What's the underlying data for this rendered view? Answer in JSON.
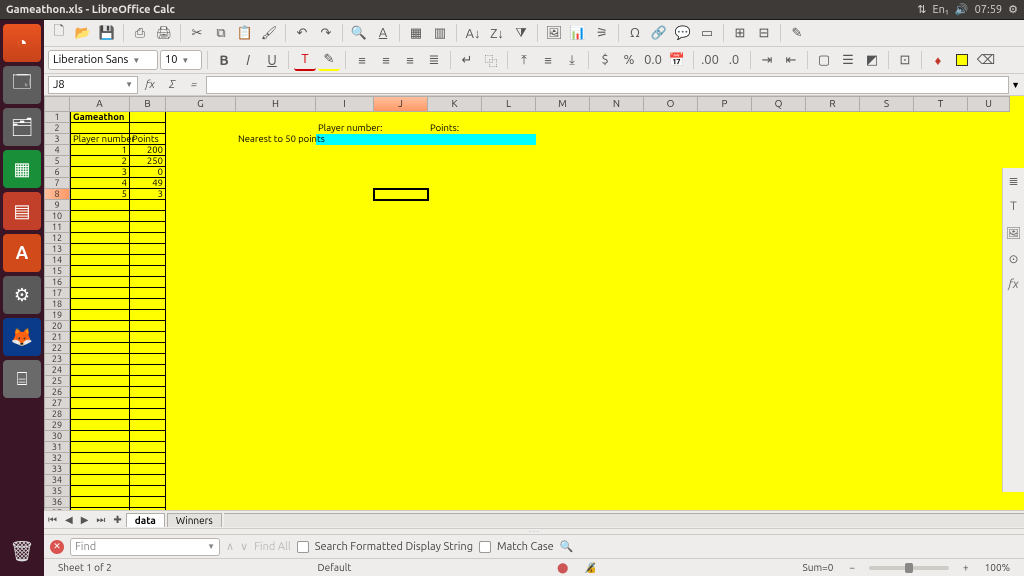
{
  "ubuntu": {
    "title": "Gameathon.xls - LibreOffice Calc",
    "time": "07:59",
    "lang": "En₁"
  },
  "launcher": {
    "apps": [
      {
        "name": "ubuntu-dash",
        "glyph": "⊚"
      },
      {
        "name": "files",
        "glyph": "🗂"
      },
      {
        "name": "files2",
        "glyph": "📁"
      },
      {
        "name": "calc",
        "glyph": "▦"
      },
      {
        "name": "impress",
        "glyph": "▤"
      },
      {
        "name": "store",
        "glyph": "A"
      },
      {
        "name": "settings",
        "glyph": "⚙"
      },
      {
        "name": "firefox",
        "glyph": "🦊"
      },
      {
        "name": "drive",
        "glyph": "⌸"
      }
    ]
  },
  "formatting": {
    "font": "Liberation Sans",
    "size": "10"
  },
  "namebox": "J8",
  "columns": [
    "A",
    "B",
    "G",
    "H",
    "I",
    "J",
    "K",
    "L",
    "M",
    "N",
    "O",
    "P",
    "Q",
    "R",
    "S",
    "T",
    "U"
  ],
  "col_widths": {
    "A": 60,
    "B": 36,
    "G": 70,
    "H": 80,
    "I": 58,
    "J": 54,
    "K": 54,
    "L": 54,
    "M": 54,
    "N": 54,
    "O": 54,
    "P": 54,
    "Q": 54,
    "R": 54,
    "S": 54,
    "T": 54,
    "U": 42
  },
  "active_cell": {
    "col": "J",
    "row": 8
  },
  "cells": {
    "A1": {
      "v": "Gameathon",
      "bold": true
    },
    "A3": {
      "v": "Player number"
    },
    "B3": {
      "v": "Points"
    },
    "A4": {
      "v": "1",
      "r": true
    },
    "B4": {
      "v": "200",
      "r": true
    },
    "A5": {
      "v": "2",
      "r": true
    },
    "B5": {
      "v": "250",
      "r": true
    },
    "A6": {
      "v": "3",
      "r": true
    },
    "B6": {
      "v": "0",
      "r": true
    },
    "A7": {
      "v": "4",
      "r": true
    },
    "B7": {
      "v": "49",
      "r": true
    },
    "A8": {
      "v": "5",
      "r": true
    },
    "B8": {
      "v": "3",
      "r": true
    },
    "H3": {
      "v": "Nearest to 50 points"
    },
    "I2": {
      "v": "Player number:"
    },
    "I3": {
      "cyan": true
    },
    "J3": {
      "cyan": true
    },
    "K2": {
      "v": "Points:"
    },
    "K3": {
      "cyan": true
    },
    "L3": {
      "cyan": true
    }
  },
  "row_count": 38,
  "tabs": {
    "active": "data",
    "others": [
      "Winners"
    ]
  },
  "findbar": {
    "placeholder": "Find",
    "findall": "Find All",
    "opt1": "Search Formatted Display String",
    "opt2": "Match Case"
  },
  "status": {
    "sheet": "Sheet 1 of 2",
    "style": "Default",
    "sum": "Sum=0",
    "zoom_minus": "−",
    "zoom_plus": "+",
    "zoom": "100%"
  }
}
